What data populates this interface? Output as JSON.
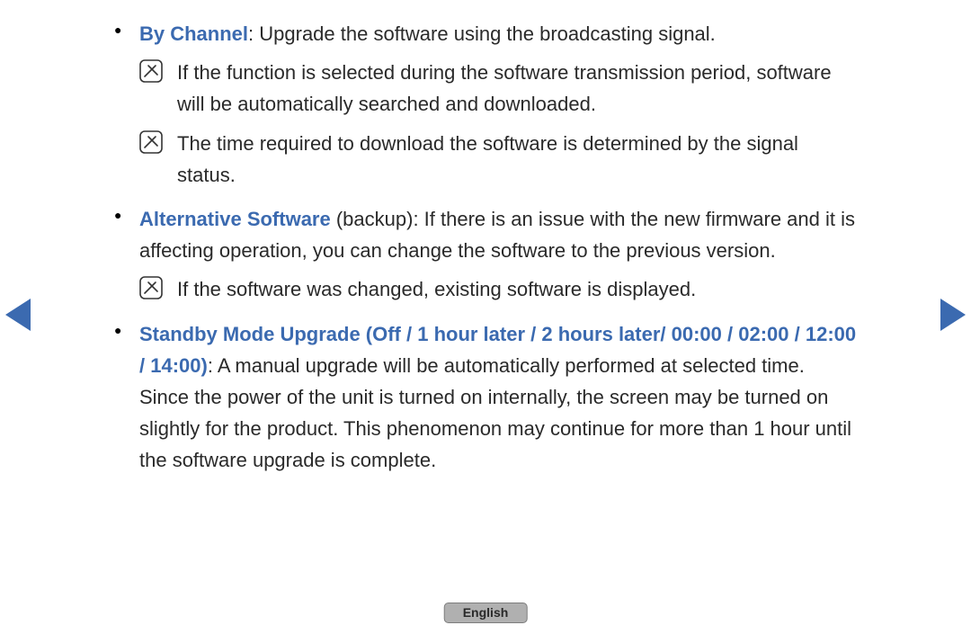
{
  "items": [
    {
      "term": "By Channel",
      "termSuffix": ": Upgrade the software using the broadcasting signal.",
      "body": "",
      "notes": [
        "If the function is selected during the software transmission period, software will be automatically searched and downloaded.",
        "The time required to download the software is determined by the signal status."
      ]
    },
    {
      "term": "Alternative Software",
      "termSuffix": " (backup): If there is an issue with the new firmware and it is affecting operation, you can change the software to the previous version.",
      "body": "",
      "notes": [
        "If the software was changed, existing software is displayed."
      ]
    },
    {
      "term": "Standby Mode Upgrade (Off / 1 hour later / 2 hours later/ 00:00 / 02:00 / 12:00 / 14:00)",
      "termSuffix": ": A manual upgrade will be automatically performed at selected time. Since the power of the unit is turned on internally, the screen may be turned on slightly for the product. This phenomenon may continue for more than 1 hour until the software upgrade is complete.",
      "body": "",
      "notes": []
    }
  ],
  "language": "English"
}
